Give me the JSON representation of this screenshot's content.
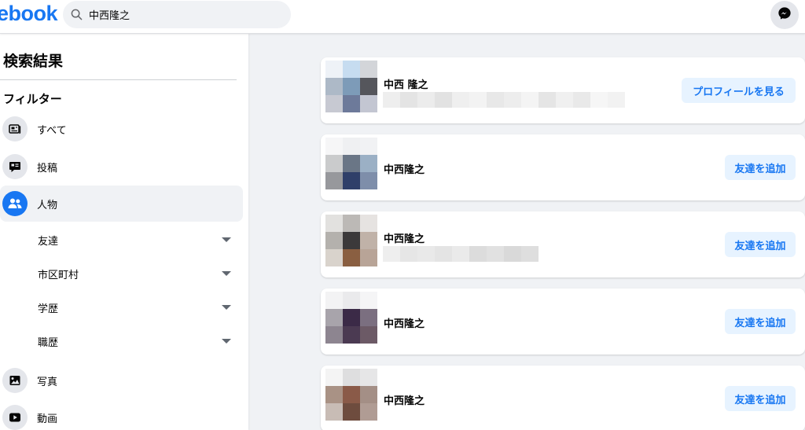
{
  "header": {
    "logo_text": "ebook",
    "search_value": "中西隆之",
    "messenger_icon": "messenger-icon"
  },
  "sidebar": {
    "title": "検索結果",
    "filter_title": "フィルター",
    "items": [
      {
        "label": "すべて",
        "icon": "feed-icon"
      },
      {
        "label": "投稿",
        "icon": "post-icon"
      },
      {
        "label": "人物",
        "icon": "people-icon"
      }
    ],
    "subfilters": [
      {
        "label": "友達"
      },
      {
        "label": "市区町村"
      },
      {
        "label": "学歴"
      },
      {
        "label": "職歴"
      }
    ],
    "more_items": [
      {
        "label": "写真",
        "icon": "photo-icon"
      },
      {
        "label": "動画",
        "icon": "video-icon"
      }
    ]
  },
  "results": [
    {
      "name": "中西 隆之",
      "button": "プロフィールを見る"
    },
    {
      "name": "中西隆之",
      "button": "友達を追加"
    },
    {
      "name": "中西隆之",
      "button": "友達を追加"
    },
    {
      "name": "中西隆之",
      "button": "友達を追加"
    },
    {
      "name": "中西隆之",
      "button": "友達を追加"
    }
  ],
  "colors": {
    "accent": "#1877f2",
    "button_bg": "#e7f3ff",
    "page_bg": "#f0f2f5"
  }
}
